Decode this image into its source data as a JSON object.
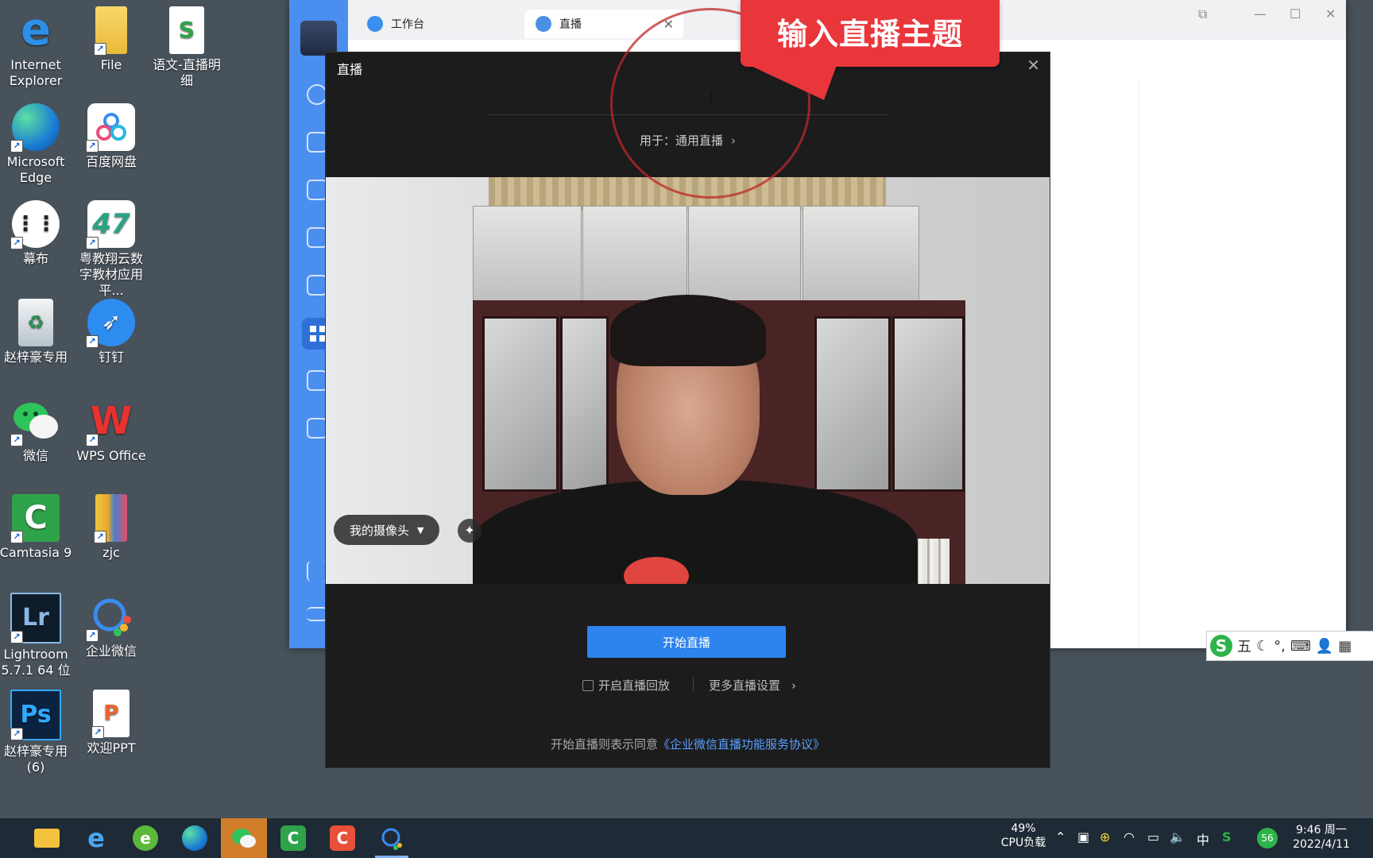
{
  "desktop": {
    "icons": [
      {
        "label": "Internet Explorer",
        "icon": "internet-explorer-icon"
      },
      {
        "label": "File",
        "icon": "folder-icon"
      },
      {
        "label": "语文-直播明细",
        "icon": "spreadsheet-icon"
      },
      {
        "label": "Microsoft Edge",
        "icon": "edge-icon"
      },
      {
        "label": "百度网盘",
        "icon": "baidu-netdisk-icon"
      },
      {
        "label": "幕布",
        "icon": "mubu-icon"
      },
      {
        "label": "粤教翔云数字教材应用平...",
        "icon": "digital-textbook-icon"
      },
      {
        "label": "赵梓豪专用",
        "icon": "recycle-bin-icon"
      },
      {
        "label": "钉钉",
        "icon": "dingtalk-icon"
      },
      {
        "label": "微信",
        "icon": "wechat-icon"
      },
      {
        "label": "WPS Office",
        "icon": "wps-icon"
      },
      {
        "label": "Camtasia 9",
        "icon": "camtasia-icon"
      },
      {
        "label": "zjc",
        "icon": "zip-archive-icon"
      },
      {
        "label": "Lightroom 5.7.1 64 位",
        "icon": "lightroom-icon"
      },
      {
        "label": "企业微信",
        "icon": "wecom-icon"
      },
      {
        "label": "赵梓豪专用 (6)",
        "icon": "photoshop-icon"
      },
      {
        "label": "欢迎PPT",
        "icon": "ppt-icon"
      }
    ]
  },
  "host_app": {
    "tabs": [
      {
        "label": "工作台",
        "icon": "workbench-icon"
      },
      {
        "label": "直播",
        "icon": "live-icon"
      }
    ],
    "window_controls": [
      "restore-icon",
      "minimize-icon",
      "maximize-icon",
      "close-icon"
    ]
  },
  "live_dialog": {
    "title": "直播",
    "topic_input": {
      "value": "",
      "placeholder": ""
    },
    "usage_prefix": "用于：",
    "usage_value": "通用直播",
    "camera_select": "我的摄像头",
    "start_button": "开始直播",
    "replay_checkbox": {
      "label": "开启直播回放",
      "checked": false
    },
    "more_settings": "更多直播设置",
    "agreement_text": "开始直播则表示同意",
    "agreement_link": "《企业微信直播功能服务协议》"
  },
  "annotation": {
    "callout": "输入直播主题"
  },
  "ime_toolbar": {
    "mode": "五",
    "items": [
      "moon-icon",
      "punctuation-icon",
      "keyboard-icon",
      "user-icon",
      "apps-icon"
    ]
  },
  "taskbar": {
    "apps": [
      {
        "name": "file-explorer-icon"
      },
      {
        "name": "internet-explorer-icon"
      },
      {
        "name": "browser-icon"
      },
      {
        "name": "edge-icon"
      },
      {
        "name": "wechat-icon",
        "active": true
      },
      {
        "name": "camtasia-icon"
      },
      {
        "name": "camtasia-recorder-icon"
      },
      {
        "name": "wecom-icon",
        "running": true
      }
    ],
    "cpu_percent": "49%",
    "cpu_label": "CPU负载",
    "ime_lang": "中",
    "battery_badge": "56",
    "time": "9:46 周一",
    "date": "2022/4/11"
  },
  "colors": {
    "accent": "#2d84ee",
    "callout_red": "#e8363b",
    "sidebar_blue": "#4a8ef0",
    "dialog_bg": "#1c1c1d"
  }
}
